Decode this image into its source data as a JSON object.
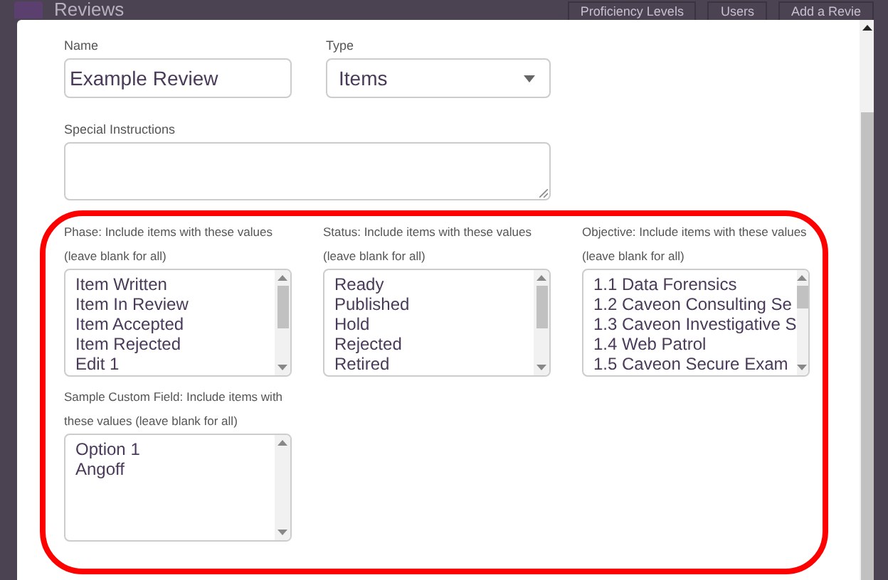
{
  "page": {
    "title": "Reviews",
    "header_buttons": [
      "Proficiency Levels",
      "Users",
      "Add a Revie"
    ]
  },
  "form": {
    "name": {
      "label": "Name",
      "value": "Example Review"
    },
    "type": {
      "label": "Type",
      "value": "Items"
    },
    "special_instructions": {
      "label": "Special Instructions"
    },
    "filters": [
      {
        "label": "Phase: Include items with these values (leave blank for all)",
        "options": [
          "Item Written",
          "Item In Review",
          "Item Accepted",
          "Item Rejected",
          "Edit 1"
        ]
      },
      {
        "label": "Status: Include items with these values (leave blank for all)",
        "options": [
          "Ready",
          "Published",
          "Hold",
          "Rejected",
          "Retired"
        ]
      },
      {
        "label": "Objective: Include items with these values (leave blank for all)",
        "options": [
          "1.1 Data Forensics",
          "1.2 Caveon Consulting Se",
          "1.3 Caveon Investigative S",
          "1.4 Web Patrol",
          "1.5 Caveon Secure Exam"
        ]
      },
      {
        "label": "Sample Custom Field: Include items with these values (leave blank for all)",
        "options": [
          "Option 1",
          "Angoff"
        ]
      }
    ]
  }
}
